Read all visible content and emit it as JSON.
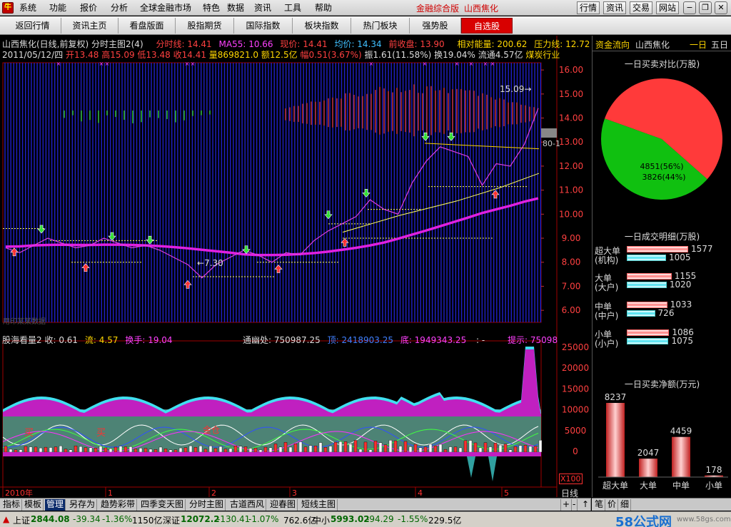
{
  "app": {
    "menu": [
      "系统",
      "功能",
      "报价",
      "分析",
      "全球金融市场",
      "特色",
      "数据",
      "资讯",
      "工具",
      "帮助"
    ],
    "version_label": "金融综合版",
    "stock_label": "山西焦化",
    "top_buttons": [
      "行情",
      "资讯",
      "交易",
      "网站"
    ]
  },
  "tabs": [
    "返回行情",
    "资讯主页",
    "看盘版面",
    "股指期货",
    "国际指数",
    "板块指数",
    "热门板块",
    "强势股",
    "自选股"
  ],
  "active_tab": 8,
  "price_panel": {
    "title_line": {
      "name": "山西焦化(日线,前复权) 分时主图2(4)",
      "fenshi": "分时线: 14.41",
      "ma55": "MA55: 10.66",
      "xianjia": "现价: 14.41",
      "junjia": "均价: 14.34",
      "qianshou": "前收盘: 13.90",
      "xiangdui": "相对能量: 200.62",
      "yali": "压力线: 12.72"
    },
    "info_line": {
      "date": "2011/05/12/四",
      "open": "开13.48",
      "high": "高15.09",
      "low": "低13.48",
      "close": "收14.41",
      "volume": "量869821.0",
      "amount": "额12.5亿",
      "change": "幅0.51(3.67%)",
      "amplitude": "振1.61(11.58%)",
      "turnover": "换19.04%",
      "float_cap": "流通4.57亿",
      "industry": "煤炭行业"
    },
    "annotation_high": "15.09",
    "annotation_low": "7.30",
    "side_tag": "80-1",
    "watermark": "用印某某数据"
  },
  "indicator_panel": {
    "name": "股海看量2",
    "shou_label": "收:",
    "shou_value": "0.61",
    "liu_label": "流:",
    "liu_value": "4.57",
    "huanshou_label": "换手:",
    "huanshou_value": "19.04",
    "tongyou": "通幽处: 750987.25",
    "ding": "顶: 2418903.25",
    "di": "底: 1949343.25",
    "sep": ": -",
    "tishi": "提示: 75098",
    "signal_texts": [
      "买",
      "买",
      "金仓"
    ],
    "multiplier": "X100"
  },
  "price_axis": [
    "16.00",
    "15.00",
    "14.00",
    "13.00",
    "12.00",
    "11.00",
    "10.00",
    "9.00",
    "8.00",
    "7.00",
    "6.00"
  ],
  "indicator_axis": [
    "25000",
    "20000",
    "15000",
    "10000",
    "5000",
    "0"
  ],
  "time_axis": [
    "2010年",
    "1",
    "2",
    "3",
    "4",
    "5"
  ],
  "period_label": "日线",
  "right_panel": {
    "header_title": "资金流向",
    "header_stock": "山西焦化",
    "period_1": "一日",
    "period_5": "五日",
    "pie_title": "一日买卖对比(万股)",
    "pie_buy": "4851(56%)",
    "pie_sell": "3826(44%)",
    "pie_buy_ratio": 0.56,
    "detail_title": "一日成交明细(万股)",
    "detail_rows": [
      {
        "label1": "超大单",
        "label2": "(机构)",
        "buy": "1577",
        "sell": "1005",
        "buy_ratio": 1.0,
        "sell_ratio": 0.64
      },
      {
        "label1": "大单",
        "label2": "(大户)",
        "buy": "1155",
        "sell": "1020",
        "buy_ratio": 0.73,
        "sell_ratio": 0.65
      },
      {
        "label1": "中单",
        "label2": "(中户)",
        "buy": "1033",
        "sell": "726",
        "buy_ratio": 0.66,
        "sell_ratio": 0.46
      },
      {
        "label1": "小单",
        "label2": "(小户)",
        "buy": "1086",
        "sell": "1075",
        "buy_ratio": 0.69,
        "sell_ratio": 0.68
      }
    ],
    "net_title": "一日买卖净额(万元)",
    "net_bars": [
      {
        "label": "超大单",
        "value": "8237",
        "num": 8237
      },
      {
        "label": "大单",
        "value": "2047",
        "num": 2047
      },
      {
        "label": "中单",
        "value": "4459",
        "num": 4459
      },
      {
        "label": "小单",
        "value": "178",
        "num": 178
      }
    ]
  },
  "bottom_tabs": [
    "指标",
    "模板",
    "管理",
    "另存为",
    "趋势彩带",
    "四季变天图",
    "分时主图",
    "古道西风",
    "迎春图",
    "短线主图"
  ],
  "active_bottom_tab": 2,
  "right_bottom_tabs": [
    "笔",
    "价",
    "细"
  ],
  "status": {
    "sh_label": "上证",
    "sh_value": "2844.08",
    "sh_change": "-39.34",
    "sh_pct": "-1.36%",
    "sh_amount": "1150亿",
    "sz_label": "深证",
    "sz_value": "12072.2",
    "sz_change": "-130.41",
    "sz_pct": "-1.07%",
    "sz_amount": "762.6亿",
    "zx_label": "中小",
    "zx_value": "5993.02",
    "zx_change": "-94.29",
    "zx_pct": "-1.55%",
    "zx_amount": "229.5亿",
    "brand": "58公式网",
    "brand_url": "www.58gs.com"
  },
  "chart_data": {
    "type": "line",
    "y_range": [
      5.5,
      16.3
    ],
    "ma55": [
      8.65,
      8.66,
      8.7,
      8.72,
      8.73,
      8.72,
      8.72,
      8.73,
      8.73,
      8.72,
      8.7,
      8.67,
      8.63,
      8.58,
      8.52,
      8.46,
      8.4,
      8.33,
      8.3,
      8.3,
      8.31,
      8.34,
      8.38,
      8.44,
      8.52,
      8.6,
      8.7,
      8.82,
      8.98,
      9.15,
      9.32,
      9.5,
      9.68,
      9.86,
      10.05,
      10.2,
      10.35,
      10.52,
      10.66
    ],
    "close": [
      8.6,
      8.4,
      8.7,
      9.0,
      8.8,
      8.6,
      8.7,
      9.0,
      8.8,
      8.6,
      8.7,
      8.5,
      8.2,
      7.9,
      7.35,
      7.9,
      8.2,
      8.5,
      8.3,
      8.0,
      8.4,
      8.3,
      8.9,
      9.3,
      9.6,
      9.9,
      10.6,
      10.2,
      10.0,
      11.3,
      12.2,
      12.8,
      12.6,
      12.4,
      11.2,
      12.1,
      12.0,
      12.9,
      14.41
    ]
  }
}
